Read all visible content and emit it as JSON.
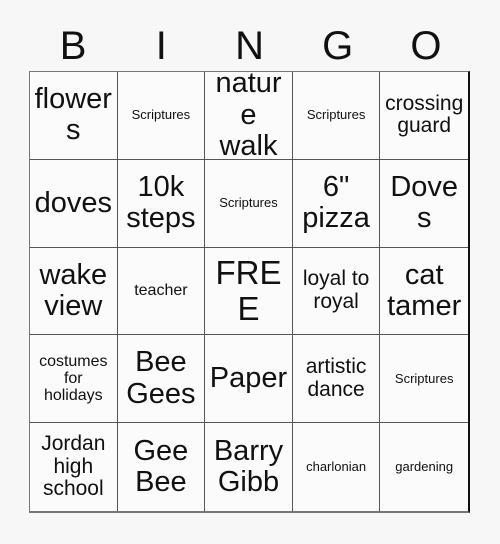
{
  "header": {
    "letters": [
      "B",
      "I",
      "N",
      "G",
      "O"
    ]
  },
  "grid": {
    "rows": [
      [
        {
          "text": "flowers",
          "size": "sz-lg"
        },
        {
          "text": "Scriptures",
          "size": "sz-xs"
        },
        {
          "text": "nature walk",
          "size": "sz-lg"
        },
        {
          "text": "Scriptures",
          "size": "sz-xs"
        },
        {
          "text": "crossing guard",
          "size": "sz-md"
        }
      ],
      [
        {
          "text": "doves",
          "size": "sz-lg"
        },
        {
          "text": "10k steps",
          "size": "sz-lg"
        },
        {
          "text": "Scriptures",
          "size": "sz-xs"
        },
        {
          "text": "6\" pizza",
          "size": "sz-lg"
        },
        {
          "text": "Doves",
          "size": "sz-lg"
        }
      ],
      [
        {
          "text": "wake view",
          "size": "sz-lg"
        },
        {
          "text": "teacher",
          "size": "sz-sm"
        },
        {
          "text": "FREE",
          "size": "sz-xl"
        },
        {
          "text": "loyal to royal",
          "size": "sz-md"
        },
        {
          "text": "cat tamer",
          "size": "sz-lg"
        }
      ],
      [
        {
          "text": "costumes for holidays",
          "size": "sz-sm"
        },
        {
          "text": "Bee Gees",
          "size": "sz-lg"
        },
        {
          "text": "Paper",
          "size": "sz-lg"
        },
        {
          "text": "artistic dance",
          "size": "sz-md"
        },
        {
          "text": "Scriptures",
          "size": "sz-xs"
        }
      ],
      [
        {
          "text": "Jordan high school",
          "size": "sz-md"
        },
        {
          "text": "Gee Bee",
          "size": "sz-lg"
        },
        {
          "text": "Barry Gibb",
          "size": "sz-lg"
        },
        {
          "text": "charlonian",
          "size": "sz-xs"
        },
        {
          "text": "gardening",
          "size": "sz-xs"
        }
      ]
    ]
  },
  "colors": {
    "page_background": "#f7f7f7",
    "cell_background": "#fbfbfb",
    "text": "#111111",
    "grid_line": "#555555"
  }
}
